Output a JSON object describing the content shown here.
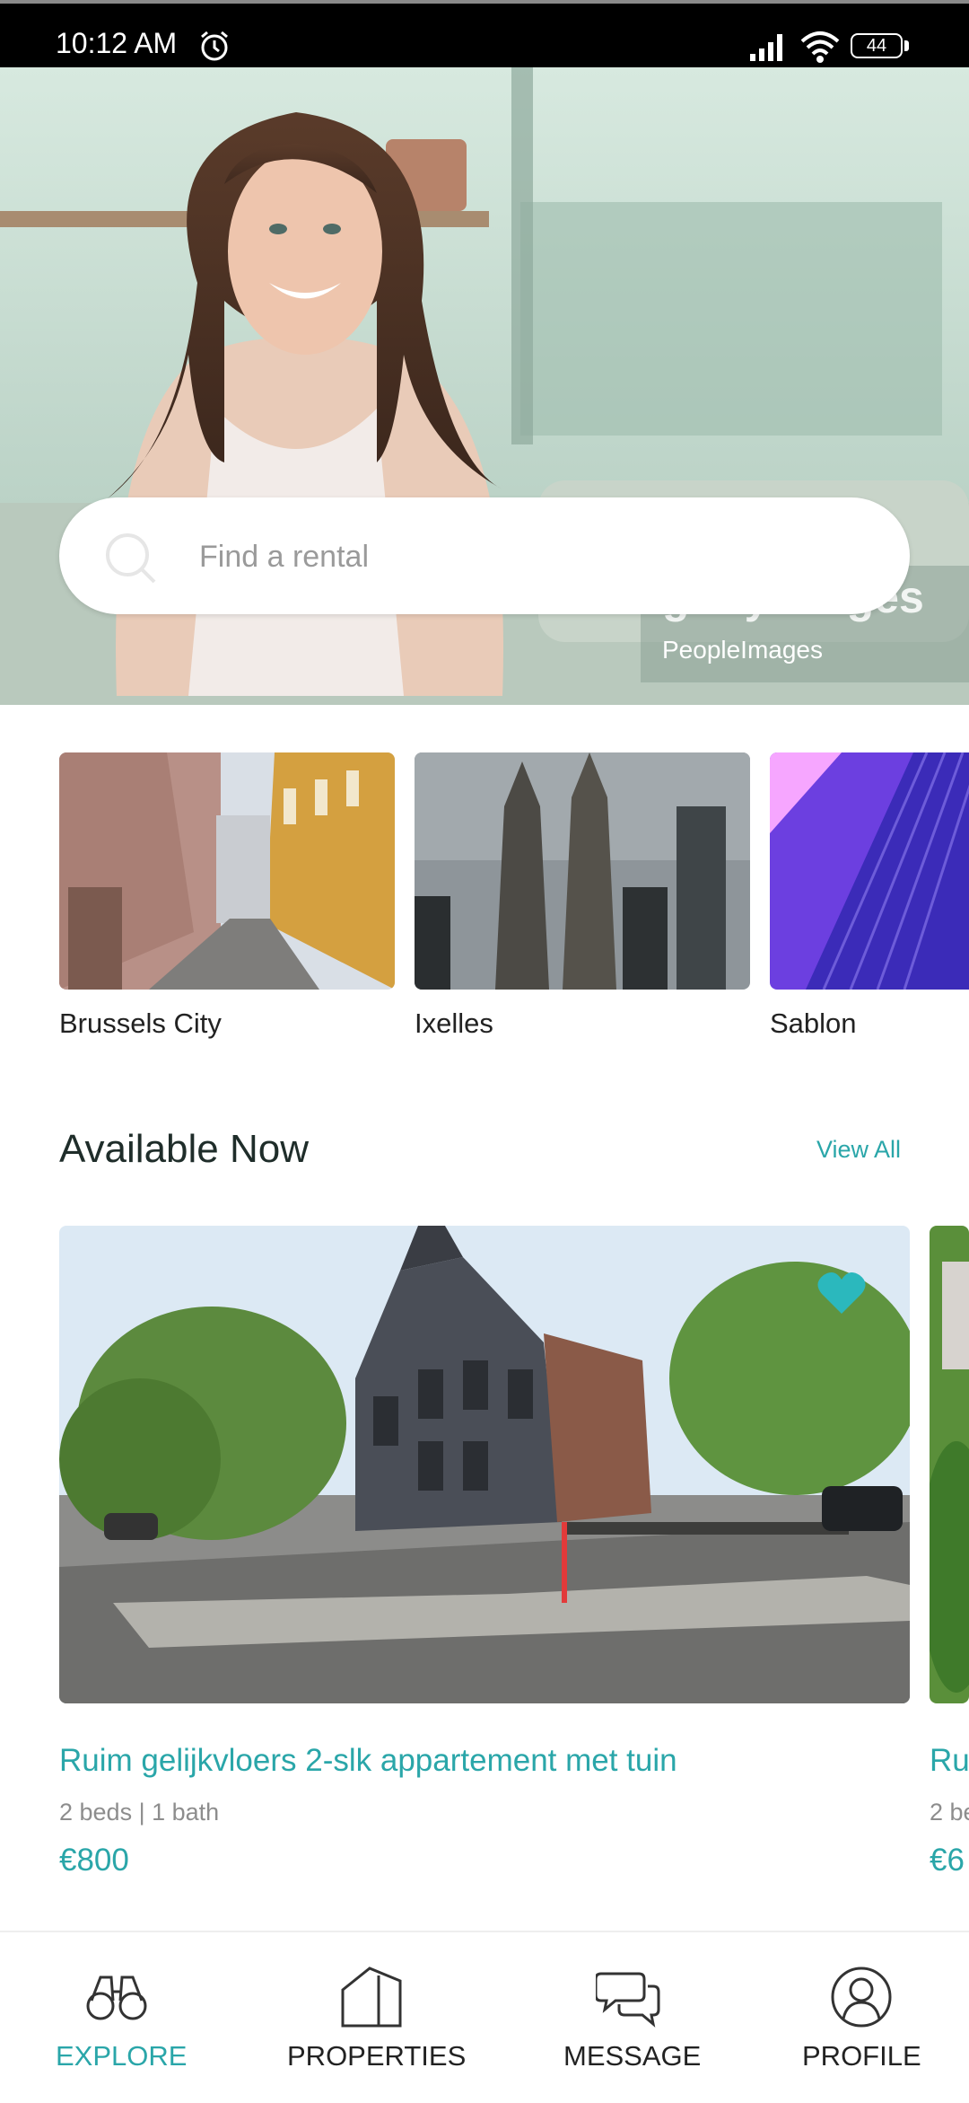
{
  "status_bar": {
    "time": "10:12 AM",
    "battery": "44"
  },
  "hero": {
    "watermark_brand": "gettyimages",
    "watermark_credit": "PeopleImages"
  },
  "search": {
    "placeholder": "Find a rental"
  },
  "neighborhoods": [
    {
      "label": "Brussels City"
    },
    {
      "label": "Ixelles"
    },
    {
      "label": "Sablon"
    }
  ],
  "available_now": {
    "title": "Available Now",
    "view_all": "View All",
    "listings": [
      {
        "title": "Ruim gelijkvloers 2-slk appartement met tuin",
        "meta": "2 beds | 1 bath",
        "price": "€800",
        "favorited": true
      },
      {
        "title": "Ru",
        "meta": "2 be",
        "price": "€6"
      }
    ]
  },
  "nav": {
    "explore": "EXPLORE",
    "properties": "PROPERTIES",
    "message": "MESSAGE",
    "profile": "PROFILE"
  },
  "colors": {
    "accent": "#2aa6a9",
    "text_dark": "#1f2d2a",
    "text_muted": "#8d8d8d"
  }
}
